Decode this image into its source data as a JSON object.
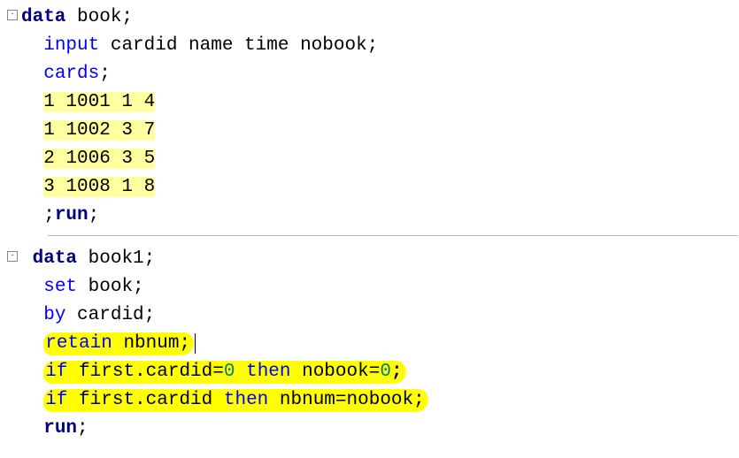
{
  "code": {
    "b1": {
      "l1_data": "data",
      "l1_rest": " book;",
      "l2_input": "input",
      "l2_rest": " cardid name time nobook;",
      "l3_cards": "cards",
      "l3_semi": ";",
      "d1": "1 1001 1 4",
      "d2": "1 1002 3 7",
      "d3": "2 1006 3 5",
      "d4": "3 1008 1 8",
      "l8_semi": ";",
      "l8_run": "run",
      "l8_semi2": ";"
    },
    "b2": {
      "l1_data": "data",
      "l1_rest": " book1;",
      "l2_set": "set",
      "l2_rest": " book;",
      "l3_by": "by",
      "l3_rest": " cardid;",
      "l4_retain": "retain",
      "l4_rest": " nbnum;",
      "l5_if": "if",
      "l5_mid": " first.cardid=",
      "l5_zero": "0",
      "l5_then": " then",
      "l5_rest": " nobook=",
      "l5_zero2": "0",
      "l5_semi": ";",
      "l6_if": "if",
      "l6_mid": " first.cardid ",
      "l6_then": "then",
      "l6_rest": " nbnum=nobook;",
      "l7_run": "run",
      "l7_semi": ";"
    }
  }
}
